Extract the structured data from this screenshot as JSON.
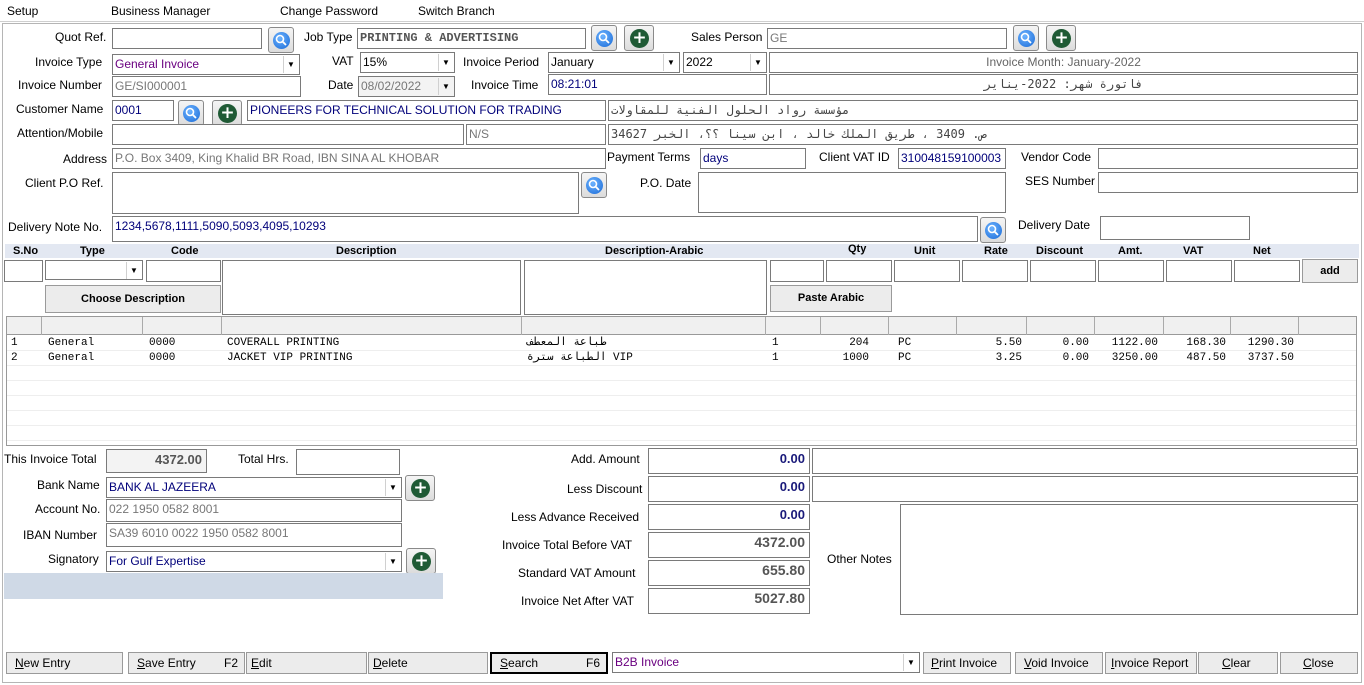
{
  "menu": {
    "setup": "Setup",
    "business_manager": "Business Manager",
    "change_password": "Change Password",
    "switch_branch": "Switch Branch"
  },
  "labels": {
    "quot_ref": "Quot Ref.",
    "job_type": "Job Type",
    "sales_person": "Sales Person",
    "invoice_type": "Invoice Type",
    "vat": "VAT",
    "invoice_period": "Invoice Period",
    "invoice_number": "Invoice Number",
    "date": "Date",
    "invoice_time": "Invoice Time",
    "customer_name": "Customer Name",
    "attention_mobile": "Attention/Mobile",
    "address": "Address",
    "payment_terms": "Payment Terms",
    "client_vat_id": "Client VAT ID",
    "vendor_code": "Vendor Code",
    "client_po_ref": "Client P.O Ref.",
    "po_date": "P.O. Date",
    "ses_number": "SES Number",
    "delivery_note_no": "Delivery Note No.",
    "delivery_date": "Delivery Date",
    "this_invoice_total": "This Invoice Total",
    "total_hrs": "Total Hrs.",
    "bank_name": "Bank Name",
    "account_no": "Account No.",
    "iban_number": "IBAN Number",
    "signatory": "Signatory",
    "add_amount": "Add. Amount",
    "less_discount": "Less Discount",
    "less_advance": "Less Advance Received",
    "total_before_vat": "Invoice Total Before VAT",
    "standard_vat": "Standard VAT Amount",
    "net_after_vat": "Invoice Net After VAT",
    "other_notes": "Other Notes"
  },
  "values": {
    "quot_ref": "",
    "job_type": "PRINTING & ADVERTISING",
    "sales_person": "GE",
    "invoice_type": "General Invoice",
    "vat": "15%",
    "invoice_month": "January",
    "invoice_year": "2022",
    "invoice_month_en": "Invoice Month: January-2022",
    "invoice_month_ar": "فاتورة شهر: 2022-يناير",
    "invoice_number": "GE/SI000001",
    "date": "08/02/2022",
    "invoice_time": "08:21:01",
    "customer_code": "0001",
    "customer_name": "PIONEERS FOR TECHNICAL SOLUTION FOR TRADING",
    "customer_name_ar": "مؤسسة رواد الحلول الفنية للمقاولات",
    "attention": "",
    "mobile": "N/S",
    "address_ar": "ص. 3409 ، طريق الملك خالد ، ابن سينا ؟؟، الخبر 34627",
    "address": "P.O. Box 3409, King Khalid BR Road, IBN SINA AL KHOBAR",
    "payment_terms": "days",
    "client_vat_id": "310048159100003",
    "vendor_code": "",
    "client_po_ref": "",
    "po_date": "",
    "ses_number": "",
    "delivery_note_no": "1234,5678,1111,5090,5093,4095,10293",
    "delivery_date": "",
    "this_invoice_total": "4372.00",
    "total_hrs": "",
    "bank_name": "BANK AL JAZEERA",
    "account_no": "022 1950 0582 8001",
    "iban": "SA39 6010 0022 1950 0582 8001",
    "signatory": "For Gulf Expertise",
    "add_amount": "0.00",
    "less_discount": "0.00",
    "less_advance": "0.00",
    "total_before_vat": "4372.00",
    "standard_vat": "655.80",
    "net_after_vat": "5027.80",
    "add_amount_note": "",
    "less_discount_note": "",
    "other_notes": ""
  },
  "item_columns": {
    "sno": "S.No",
    "type": "Type",
    "code": "Code",
    "description": "Description",
    "description_arabic": "Description-Arabic",
    "qty": "Qty",
    "unit": "Unit",
    "rate": "Rate",
    "discount": "Discount",
    "amt": "Amt.",
    "vat": "VAT",
    "net": "Net"
  },
  "item_buttons": {
    "add": "add",
    "choose_description": "Choose Description",
    "paste_arabic": "Paste Arabic"
  },
  "rows": [
    {
      "sno": "1",
      "type": "General",
      "code": "0000",
      "desc": "COVERALL PRINTING",
      "desc_ar": "طباعة المعطف",
      "c6": "1",
      "qty": "204",
      "unit": "PC",
      "rate": "5.50",
      "discount": "0.00",
      "amt": "1122.00",
      "vat": "168.30",
      "net": "1290.30"
    },
    {
      "sno": "2",
      "type": "General",
      "code": "0000",
      "desc": "JACKET VIP PRINTING",
      "desc_ar": "الطباعة سترة VIP",
      "c6": "1",
      "qty": "1000",
      "unit": "PC",
      "rate": "3.25",
      "discount": "0.00",
      "amt": "3250.00",
      "vat": "487.50",
      "net": "3737.50"
    }
  ],
  "bottom": {
    "new_entry_u": "N",
    "new_entry": "ew Entry",
    "save_entry_u": "S",
    "save_entry": "ave Entry",
    "save_key": "F2",
    "edit_u": "E",
    "edit": "dit",
    "delete_u": "D",
    "delete": "elete",
    "search_u": "S",
    "search": "earch",
    "search_key": "F6",
    "b2b": "B2B Invoice",
    "print_u": "P",
    "print": "rint Invoice",
    "void_u": "V",
    "void": "oid Invoice",
    "report_u": "I",
    "report": "nvoice Report",
    "clear_u": "C",
    "clear": "lear",
    "close_u": "C",
    "close": "lose"
  },
  "colors": {
    "header_bar": "#e3e8f2",
    "panel": "#cfd9e6",
    "green_icon": "#1f5a35",
    "blue_icon": "#1a6ad6"
  }
}
